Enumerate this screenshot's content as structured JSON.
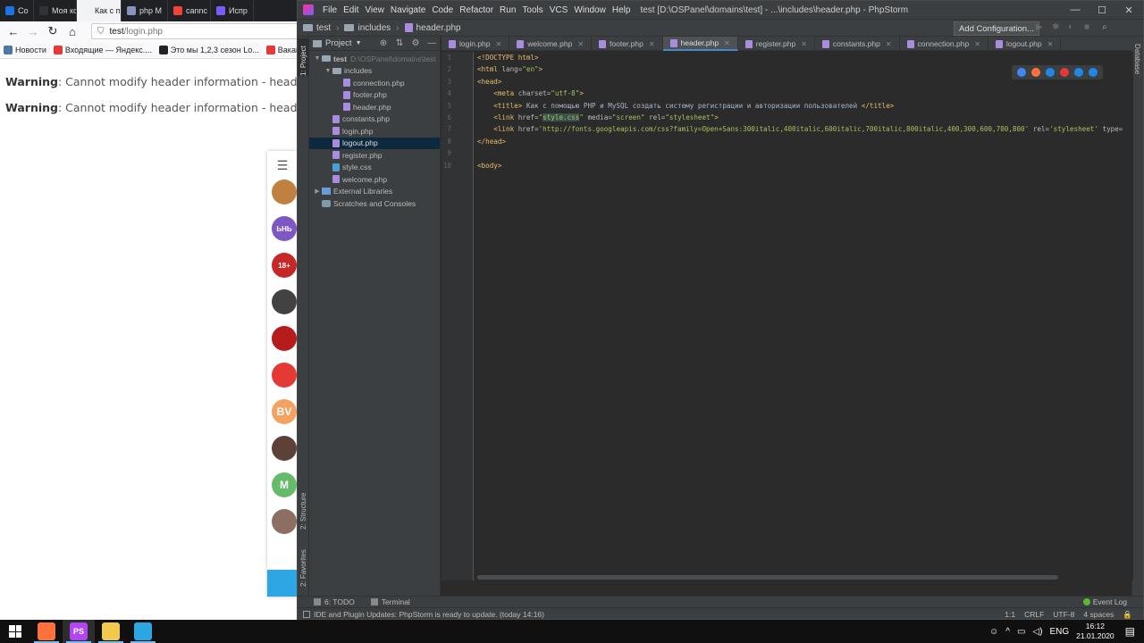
{
  "browser": {
    "tabs": [
      {
        "label": "Со",
        "color": "#1a73e8"
      },
      {
        "label": "Моя корз",
        "color": "#333333"
      },
      {
        "label": "Как с п",
        "color": "#f2f2f2",
        "active": true
      },
      {
        "label": "php M",
        "color": "#8892bf"
      },
      {
        "label": "cannc",
        "color": "#f44336"
      },
      {
        "label": "Испр",
        "color": "#7a5cff"
      }
    ],
    "tab_close": "✕",
    "url_host": "test",
    "url_path": "/login.php",
    "bookmarks": [
      "Новости",
      "Входящие — Яндекс....",
      "Это мы 1,2,3 сезон Lo...",
      "Вакансия Ju"
    ],
    "warning_label": "Warning",
    "warning_text": ": Cannot modify header information - headers already sent by",
    "warnings_count": 2,
    "telegram_avatars": [
      {
        "text": "",
        "color": "#c08040"
      },
      {
        "text": "ЬНЬ",
        "color": "#7e57c2"
      },
      {
        "text": "18+",
        "color": "#c62828"
      },
      {
        "text": "",
        "color": "#424242"
      },
      {
        "text": "",
        "color": "#b71c1c"
      },
      {
        "text": "",
        "color": "#e53935"
      },
      {
        "text": "BV",
        "color": "#f4a261"
      },
      {
        "text": "",
        "color": "#5d4037"
      },
      {
        "text": "M",
        "color": "#66bb6a"
      },
      {
        "text": "",
        "color": "#8d6e63"
      }
    ]
  },
  "ide": {
    "menu": [
      "File",
      "Edit",
      "View",
      "Navigate",
      "Code",
      "Refactor",
      "Run",
      "Tools",
      "VCS",
      "Window",
      "Help"
    ],
    "window_title": "test [D:\\OSPanel\\domains\\test] - ...\\includes\\header.php - PhpStorm",
    "breadcrumbs": [
      "test",
      "includes",
      "header.php"
    ],
    "add_configuration": "Add Configuration...",
    "project_label": "Project",
    "left_tools": [
      "1: Project",
      "2: Structure",
      "2: Favorites"
    ],
    "right_tools": [
      "Database"
    ],
    "tree": [
      {
        "label": "test",
        "extra": "D:\\OSPanel\\domains\\test",
        "type": "folder",
        "depth": 0,
        "open": true
      },
      {
        "label": "includes",
        "type": "folder",
        "depth": 1,
        "open": true
      },
      {
        "label": "connection.php",
        "type": "php",
        "depth": 2
      },
      {
        "label": "footer.php",
        "type": "php",
        "depth": 2
      },
      {
        "label": "header.php",
        "type": "php",
        "depth": 2
      },
      {
        "label": "constants.php",
        "type": "php",
        "depth": 1
      },
      {
        "label": "login.php",
        "type": "php",
        "depth": 1
      },
      {
        "label": "logout.php",
        "type": "php",
        "depth": 1,
        "selected": true
      },
      {
        "label": "register.php",
        "type": "php",
        "depth": 1
      },
      {
        "label": "style.css",
        "type": "css",
        "depth": 1
      },
      {
        "label": "welcome.php",
        "type": "php",
        "depth": 1
      },
      {
        "label": "External Libraries",
        "type": "lib",
        "depth": 0,
        "closed": true
      },
      {
        "label": "Scratches and Consoles",
        "type": "scr",
        "depth": 0
      }
    ],
    "tabs": [
      {
        "label": "login.php"
      },
      {
        "label": "welcome.php"
      },
      {
        "label": "footer.php"
      },
      {
        "label": "header.php",
        "active": true
      },
      {
        "label": "register.php"
      },
      {
        "label": "constants.php"
      },
      {
        "label": "connection.php"
      },
      {
        "label": "logout.php"
      }
    ],
    "line_numbers": [
      "1",
      "2",
      "3",
      "4",
      "5",
      "6",
      "7",
      "8",
      "9",
      "10"
    ],
    "code_lines": [
      [
        {
          "t": "<!DOCTYPE html>",
          "c": "tag"
        }
      ],
      [
        {
          "t": "<html ",
          "c": "tag"
        },
        {
          "t": "lang=",
          "c": "attr"
        },
        {
          "t": "\"en\"",
          "c": "val"
        },
        {
          "t": ">",
          "c": "tag"
        }
      ],
      [
        {
          "t": "<head>",
          "c": "tag"
        }
      ],
      [
        {
          "t": "    <meta ",
          "c": "tag"
        },
        {
          "t": "charset=",
          "c": "attr"
        },
        {
          "t": "\"utf-8\"",
          "c": "val"
        },
        {
          "t": ">",
          "c": "tag"
        }
      ],
      [
        {
          "t": "    <title>",
          "c": "tag"
        },
        {
          "t": " Как с помощью PHP и MySQL создать систему регистрации и авторизации пользователей ",
          "c": "txt"
        },
        {
          "t": "</title>",
          "c": "tag"
        }
      ],
      [
        {
          "t": "    <link ",
          "c": "tag"
        },
        {
          "t": "href=",
          "c": "attr"
        },
        {
          "t": "\"",
          "c": "val"
        },
        {
          "t": "style.css",
          "c": "hl"
        },
        {
          "t": "\" ",
          "c": "val"
        },
        {
          "t": "media=",
          "c": "attr"
        },
        {
          "t": "\"screen\" ",
          "c": "val"
        },
        {
          "t": "rel=",
          "c": "attr"
        },
        {
          "t": "\"stylesheet\"",
          "c": "val"
        },
        {
          "t": ">",
          "c": "tag"
        }
      ],
      [
        {
          "t": "    <link ",
          "c": "tag"
        },
        {
          "t": "href=",
          "c": "attr"
        },
        {
          "t": "'http://fonts.googleapis.com/css?family=Open+Sans:300italic,400italic,600italic,700italic,800italic,400,300,600,700,800' ",
          "c": "val"
        },
        {
          "t": "rel=",
          "c": "attr"
        },
        {
          "t": "'stylesheet' ",
          "c": "val"
        },
        {
          "t": "type=",
          "c": "attr"
        }
      ],
      [
        {
          "t": "</head>",
          "c": "tag"
        }
      ],
      [],
      [
        {
          "t": "<body>",
          "c": "tag"
        }
      ]
    ],
    "browser_icons": [
      "#4285f4",
      "#ff7139",
      "#1e88e5",
      "#e53935",
      "#1e88e5",
      "#1e88e5"
    ],
    "bottom_tools": [
      "6: TODO",
      "Terminal"
    ],
    "event_log": "Event Log",
    "status_message": "IDE and Plugin Updates: PhpStorm is ready to update. (today 14:16)",
    "status_right": [
      "1:1",
      "CRLF",
      "UTF-8",
      "4 spaces"
    ]
  },
  "taskbar": {
    "apps": [
      {
        "name": "firefox-icon",
        "color": "#ff7139"
      },
      {
        "name": "phpstorm-icon",
        "color": "#b345f1",
        "active": true,
        "label": "PS"
      },
      {
        "name": "explorer-icon",
        "color": "#f2c94c"
      },
      {
        "name": "telegram-icon",
        "color": "#2ea6e3"
      }
    ],
    "lang": "ENG",
    "time": "16:12",
    "date": "21.01.2020"
  }
}
